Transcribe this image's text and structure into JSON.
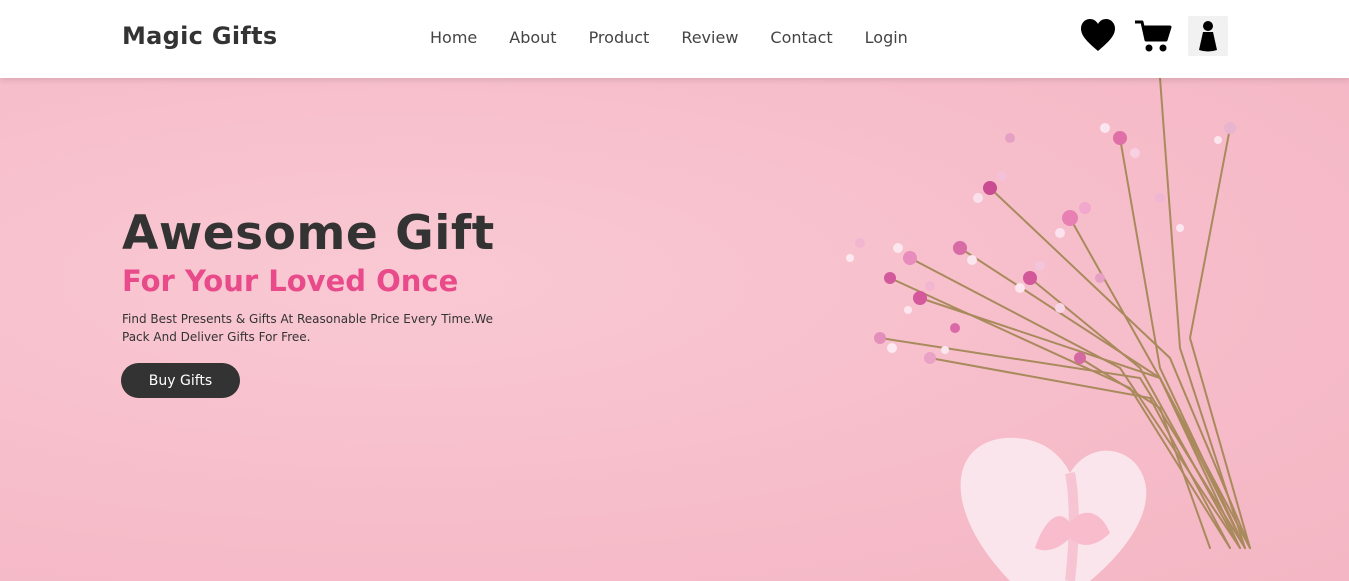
{
  "header": {
    "logo": "Magic Gifts",
    "nav": [
      "Home",
      "About",
      "Product",
      "Review",
      "Contact",
      "Login"
    ],
    "icons": [
      "heart-icon",
      "cart-icon",
      "user-icon"
    ]
  },
  "hero": {
    "title": "Awesome Gift",
    "subtitle": "For Your Loved Once",
    "description": "Find Best Presents & Gifts At Reasonable Price Every Time.We Pack And Deliver Gifts For Free.",
    "button_label": "Buy Gifts"
  },
  "colors": {
    "background": "#f7c3cf",
    "accent": "#e84a8a",
    "dark": "#333333",
    "header": "#ffffff"
  }
}
